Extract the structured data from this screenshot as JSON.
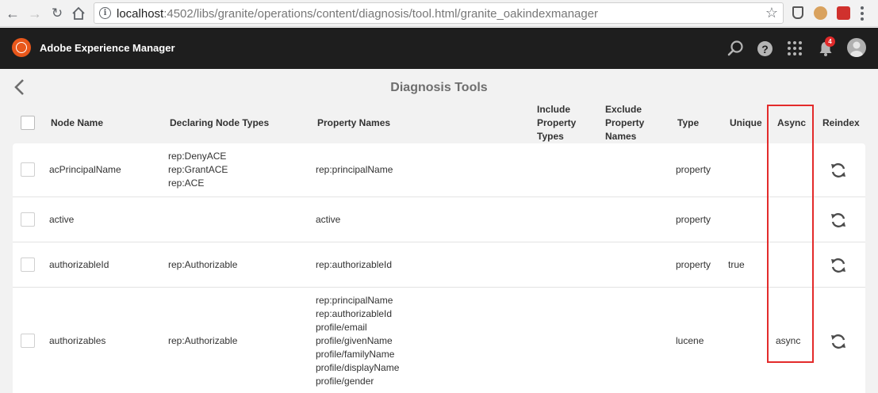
{
  "browser": {
    "url_host": "localhost",
    "url_path": ":4502/libs/granite/operations/content/diagnosis/tool.html/granite_oakindexmanager"
  },
  "app": {
    "title": "Adobe Experience Manager",
    "notification_count": "4"
  },
  "page": {
    "title": "Diagnosis Tools"
  },
  "table": {
    "columns": {
      "node_name": "Node Name",
      "declaring": "Declaring Node Types",
      "property_names": "Property Names",
      "include": [
        "Include",
        "Property",
        "Types"
      ],
      "exclude": [
        "Exclude",
        "Property",
        "Names"
      ],
      "type": "Type",
      "unique": "Unique",
      "async": "Async",
      "reindex": "Reindex"
    },
    "rows": [
      {
        "name": "acPrincipalName",
        "declaring": [
          "rep:DenyACE",
          "rep:GrantACE",
          "rep:ACE"
        ],
        "properties": [
          "rep:principalName"
        ],
        "type": "property",
        "unique": "",
        "async": ""
      },
      {
        "name": "active",
        "declaring": [],
        "properties": [
          "active"
        ],
        "type": "property",
        "unique": "",
        "async": ""
      },
      {
        "name": "authorizableId",
        "declaring": [
          "rep:Authorizable"
        ],
        "properties": [
          "rep:authorizableId"
        ],
        "type": "property",
        "unique": "true",
        "async": ""
      },
      {
        "name": "authorizables",
        "declaring": [
          "rep:Authorizable"
        ],
        "properties": [
          "rep:principalName",
          "rep:authorizableId",
          "profile/email",
          "profile/givenName",
          "profile/familyName",
          "profile/displayName",
          "profile/gender"
        ],
        "type": "lucene",
        "unique": "",
        "async": "async"
      }
    ]
  },
  "colors": {
    "topbar": "#1e1e1e",
    "brand": "#e8571b",
    "highlight": "#e32b2b"
  }
}
